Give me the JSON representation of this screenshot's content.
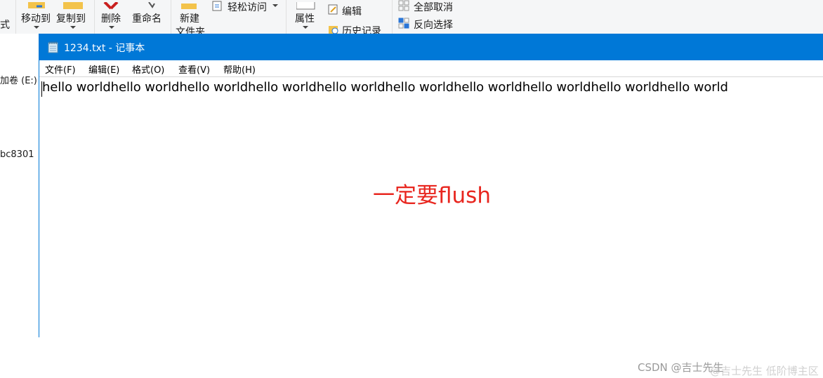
{
  "explorer": {
    "ribbon": {
      "format_partial": "式",
      "move_to": "移动到",
      "copy_to": "复制到",
      "delete": "删除",
      "rename": "重命名",
      "new_folder": "新建",
      "new_folder_line2": "文件夹",
      "easy_access": "轻松访问",
      "properties": "属性",
      "edit": "编辑",
      "history": "历史记录",
      "select_none": "全部取消",
      "invert_selection": "反向选择"
    },
    "left_pane": {
      "drive_label": "加卷 (E:)",
      "item_label": "bc8301"
    },
    "colors": {
      "ribbon_bg": "#f5f6f7",
      "accent": "#0078d7"
    }
  },
  "notepad": {
    "title": "1234.txt - 记事本",
    "menu": [
      "文件(F)",
      "编辑(E)",
      "格式(O)",
      "查看(V)",
      "帮助(H)"
    ],
    "content": "hello worldhello worldhello worldhello worldhello worldhello worldhello worldhello worldhello worldhello world"
  },
  "annotation": {
    "text": "一定要flush",
    "color": "#e8261f"
  },
  "watermark": {
    "text": "CSDN @吉士先生",
    "overlay_text": "@吉士先生   低阶博主区"
  }
}
